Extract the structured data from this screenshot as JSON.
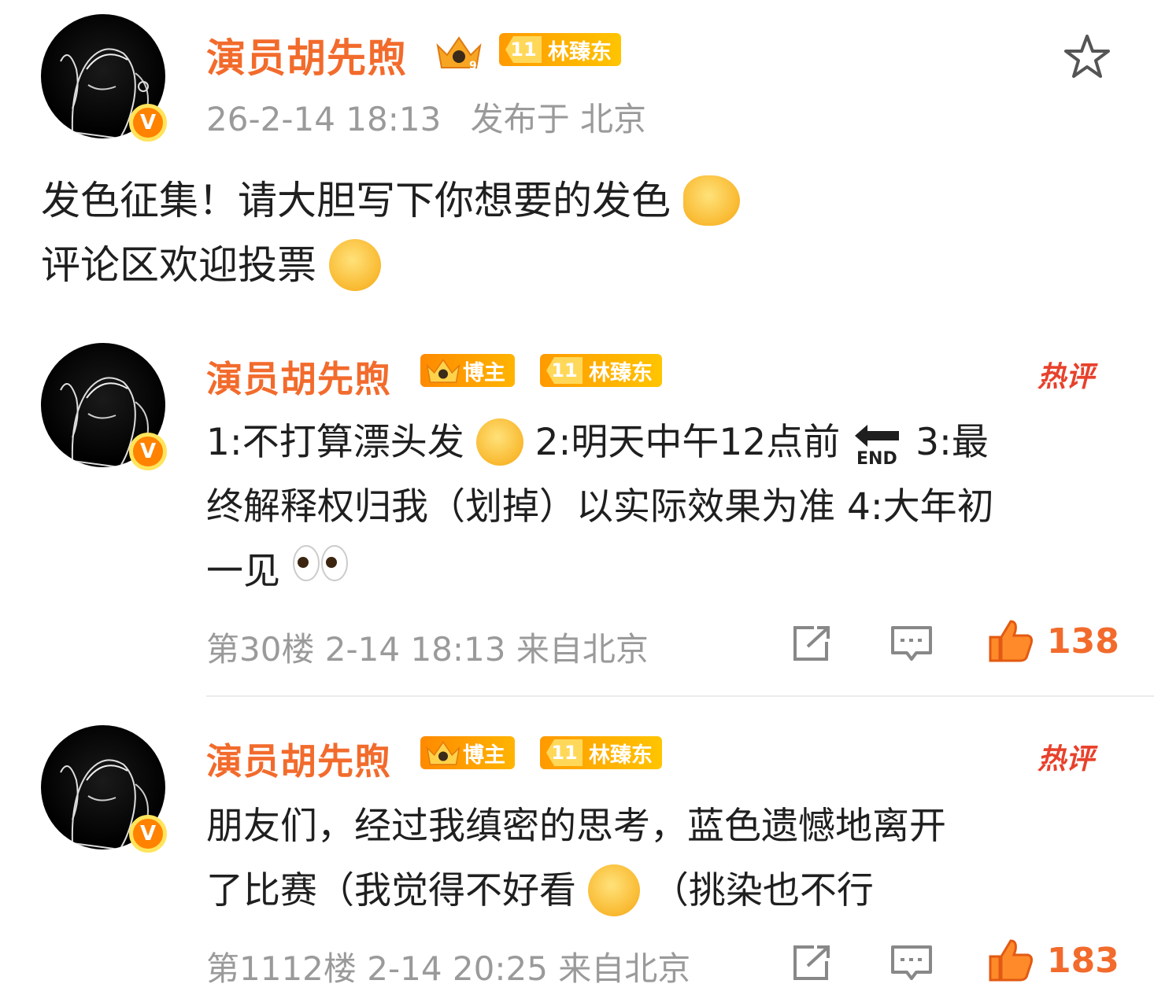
{
  "post": {
    "author": "演员胡先煦",
    "fan_tag": "林臻东",
    "fan_level": "11",
    "time": "26-2-14 18:13",
    "location": "发布于 北京",
    "text_line1": "发色征集！请大胆写下你想要的发色",
    "text_line2": "评论区欢迎投票"
  },
  "comments": [
    {
      "author": "演员胡先煦",
      "badge_blogger": "博主",
      "fan_tag": "林臻东",
      "fan_level": "11",
      "hot_label": "热评",
      "line1_a": "1:不打算漂头发",
      "line1_b": "2:明天中午12点前",
      "end_label": "END",
      "line1_c": "3:最",
      "line2": "终解释权归我（划掉）以实际效果为准 4:大年初",
      "line3": "一见",
      "floor_meta": "第30楼 2-14 18:13 来自北京",
      "likes": "138"
    },
    {
      "author": "演员胡先煦",
      "badge_blogger": "博主",
      "fan_tag": "林臻东",
      "fan_level": "11",
      "hot_label": "热评",
      "line1": "朋友们，经过我缜密的思考，蓝色遗憾地离开",
      "line2_a": "了比赛（我觉得不好看",
      "line2_b": "（挑染也不行",
      "floor_meta": "第1112楼 2-14 20:25 来自北京",
      "likes": "183"
    }
  ],
  "colors": {
    "accent": "#f26b2c",
    "hot": "#e8412c",
    "meta": "#9a9a9a",
    "verified": "#ff8200"
  },
  "icons": [
    "star-icon",
    "verified-icon",
    "crown-icon",
    "share-icon",
    "comment-icon",
    "like-icon",
    "point-left-emoji",
    "wink-emoji",
    "thinking-emoji",
    "end-arrow-emoji",
    "eyes-emoji",
    "facepalm-emoji"
  ]
}
